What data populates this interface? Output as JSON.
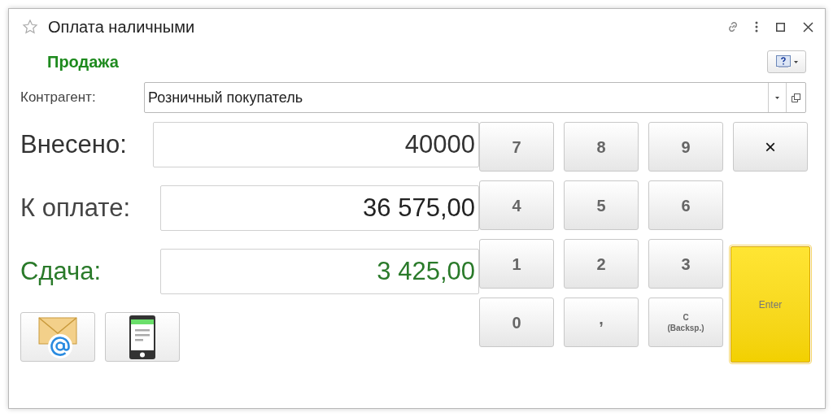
{
  "window": {
    "title": "Оплата наличными"
  },
  "operation": "Продажа",
  "counterparty": {
    "label": "Контрагент:",
    "value": "Розничный покупатель"
  },
  "amounts": [
    {
      "label": "Внесено:",
      "value": "40000",
      "kind": "paid"
    },
    {
      "label": "К оплате:",
      "value": "36 575,00",
      "kind": "due"
    },
    {
      "label": "Сдача:",
      "value": "3 425,00",
      "kind": "change"
    }
  ],
  "keypad": {
    "keys": [
      {
        "label": "7",
        "kind": "digit"
      },
      {
        "label": "8",
        "kind": "digit"
      },
      {
        "label": "9",
        "kind": "digit"
      },
      {
        "label": "4",
        "kind": "digit"
      },
      {
        "label": "5",
        "kind": "digit"
      },
      {
        "label": "6",
        "kind": "digit"
      },
      {
        "label": "1",
        "kind": "digit"
      },
      {
        "label": "2",
        "kind": "digit"
      },
      {
        "label": "3",
        "kind": "digit"
      },
      {
        "label": "0",
        "kind": "digit"
      },
      {
        "label": ",",
        "kind": "separator"
      },
      {
        "label": "C\n(Backsp.)",
        "kind": "backspace"
      }
    ],
    "side_keys": [
      {
        "label": "×",
        "kind": "clear"
      },
      {
        "label": "Enter",
        "kind": "enter"
      }
    ]
  }
}
